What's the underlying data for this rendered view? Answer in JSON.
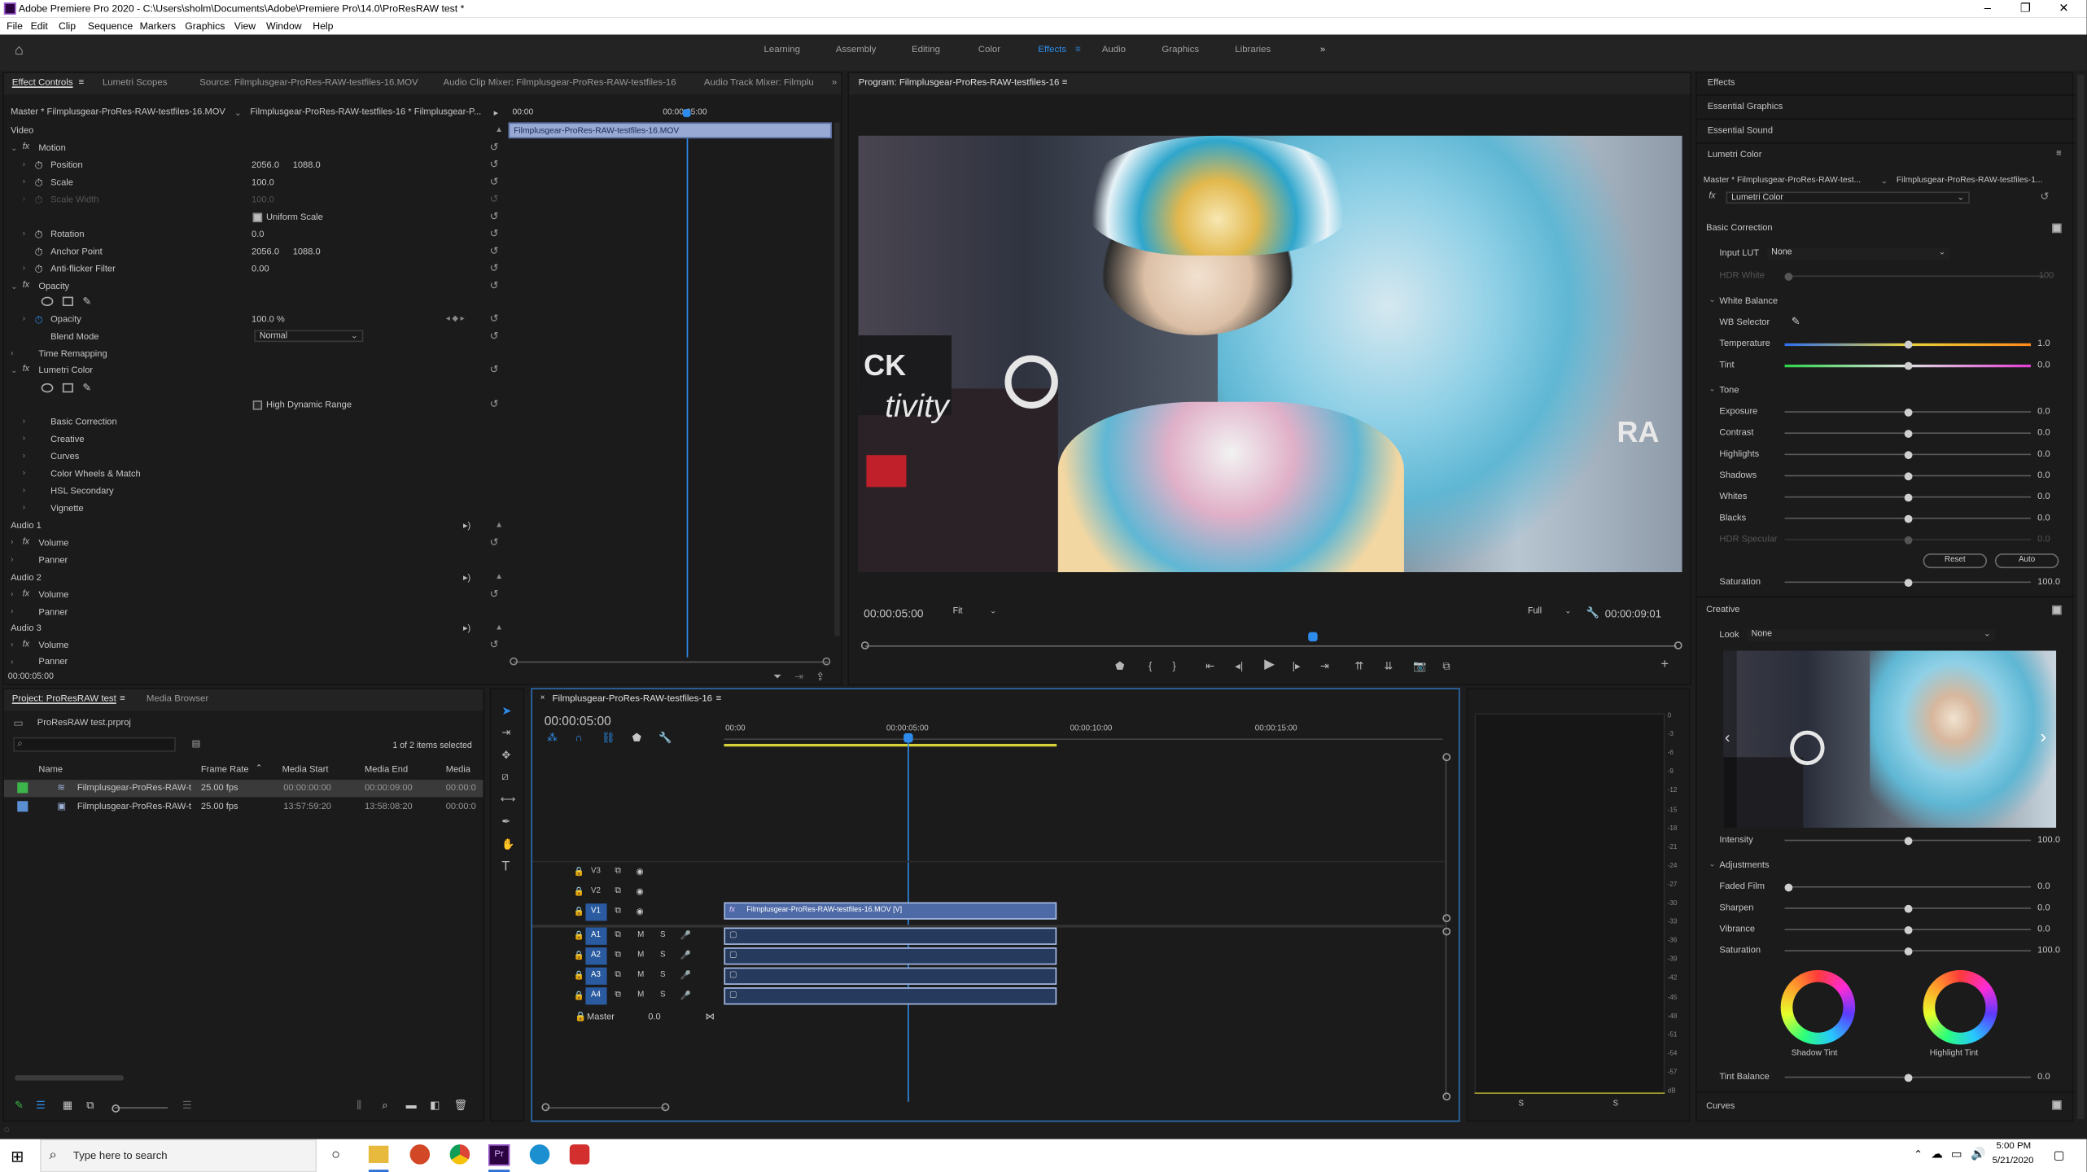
{
  "window": {
    "title": "Adobe Premiere Pro 2020 - C:\\Users\\sholm\\Documents\\Adobe\\Premiere Pro\\14.0\\ProResRAW test *",
    "minimize": "–",
    "maximize": "❐",
    "close": "✕"
  },
  "menu": [
    "File",
    "Edit",
    "Clip",
    "Sequence",
    "Markers",
    "Graphics",
    "View",
    "Window",
    "Help"
  ],
  "workspaces": [
    "Learning",
    "Assembly",
    "Editing",
    "Color",
    "Effects",
    "Audio",
    "Graphics",
    "Libraries"
  ],
  "active_workspace": "Effects",
  "effect_controls": {
    "tabs": [
      "Effect Controls",
      "Lumetri Scopes",
      "Source: Filmplusgear-ProRes-RAW-testfiles-16.MOV",
      "Audio Clip Mixer: Filmplusgear-ProRes-RAW-testfiles-16",
      "Audio Track Mixer: Filmplu"
    ],
    "master": "Master * Filmplusgear-ProRes-RAW-testfiles-16.MOV",
    "sequence": "Filmplusgear-ProRes-RAW-testfiles-16 * Filmplusgear-P...",
    "ruler": [
      "00:00",
      "00:00:05:00"
    ],
    "clip_label": "Filmplusgear-ProRes-RAW-testfiles-16.MOV",
    "video": "Video",
    "motion": "Motion",
    "position": "Position",
    "position_x": "2056.0",
    "position_y": "1088.0",
    "scale": "Scale",
    "scale_val": "100.0",
    "scale_width": "Scale Width",
    "scale_width_val": "100.0",
    "uniform_scale": "Uniform Scale",
    "rotation": "Rotation",
    "rotation_val": "0.0",
    "anchor": "Anchor Point",
    "anchor_x": "2056.0",
    "anchor_y": "1088.0",
    "antiflicker": "Anti-flicker Filter",
    "antiflicker_val": "0.00",
    "opacity_grp": "Opacity",
    "opacity": "Opacity",
    "opacity_val": "100.0 %",
    "blend": "Blend Mode",
    "blend_val": "Normal",
    "time_remap": "Time Remapping",
    "lumetri": "Lumetri Color",
    "hdr": "High Dynamic Range",
    "lumetri_items": [
      "Basic Correction",
      "Creative",
      "Curves",
      "Color Wheels & Match",
      "HSL Secondary",
      "Vignette"
    ],
    "audio1": "Audio 1",
    "audio2": "Audio 2",
    "audio3": "Audio 3",
    "volume": "Volume",
    "panner": "Panner",
    "timecode": "00:00:05:00"
  },
  "program": {
    "title": "Program: Filmplusgear-ProRes-RAW-testfiles-16",
    "timecode": "00:00:05:00",
    "fit": "Fit",
    "full": "Full",
    "duration": "00:00:09:01",
    "image_text": [
      "CK",
      "tivity",
      "RA"
    ]
  },
  "effects_panel": {
    "items": [
      "Effects",
      "Essential Graphics",
      "Essential Sound"
    ],
    "lumetri_title": "Lumetri Color",
    "master": "Master * Filmplusgear-ProRes-RAW-test...",
    "sequence": "Filmplusgear-ProRes-RAW-testfiles-1...",
    "effect_select": "Lumetri Color",
    "basic_correction": "Basic Correction",
    "input_lut": "Input LUT",
    "input_lut_val": "None",
    "hdr_white": "HDR White",
    "hdr_white_val": "100",
    "white_balance": "White Balance",
    "wb_selector": "WB Selector",
    "temperature": "Temperature",
    "temperature_val": "1.0",
    "tint": "Tint",
    "tint_val": "0.0",
    "tone": "Tone",
    "tone_rows": [
      {
        "label": "Exposure",
        "value": "0.0"
      },
      {
        "label": "Contrast",
        "value": "0.0"
      },
      {
        "label": "Highlights",
        "value": "0.0"
      },
      {
        "label": "Shadows",
        "value": "0.0"
      },
      {
        "label": "Whites",
        "value": "0.0"
      },
      {
        "label": "Blacks",
        "value": "0.0"
      },
      {
        "label": "HDR Specular",
        "value": "0.0"
      }
    ],
    "reset": "Reset",
    "auto": "Auto",
    "saturation": "Saturation",
    "saturation_val": "100.0",
    "creative": "Creative",
    "look": "Look",
    "look_val": "None",
    "intensity": "Intensity",
    "intensity_val": "100.0",
    "adjustments": "Adjustments",
    "adj_rows": [
      {
        "label": "Faded Film",
        "value": "0.0"
      },
      {
        "label": "Sharpen",
        "value": "0.0"
      },
      {
        "label": "Vibrance",
        "value": "0.0"
      },
      {
        "label": "Saturation",
        "value": "100.0"
      }
    ],
    "shadow_tint": "Shadow Tint",
    "highlight_tint": "Highlight Tint",
    "tint_balance": "Tint Balance",
    "tint_balance_val": "0.0",
    "curves": "Curves"
  },
  "project": {
    "tabs": [
      "Project: ProResRAW test",
      "Media Browser"
    ],
    "file": "ProResRAW test.prproj",
    "selected": "1 of 2 items selected",
    "columns": [
      "Name",
      "Frame Rate",
      "Media Start",
      "Media End",
      "Media"
    ],
    "rows": [
      {
        "name": "Filmplusgear-ProRes-RAW-t",
        "fps": "25.00 fps",
        "start": "00:00:00:00",
        "end": "00:00:09:00",
        "media": "00:00:0",
        "color": "#3cb64a"
      },
      {
        "name": "Filmplusgear-ProRes-RAW-t",
        "fps": "25.00 fps",
        "start": "13:57:59:20",
        "end": "13:58:08:20",
        "media": "00:00:0",
        "color": "#5b8fd4"
      }
    ]
  },
  "timeline": {
    "title": "Filmplusgear-ProRes-RAW-testfiles-16",
    "timecode": "00:00:05:00",
    "ruler": [
      "00:00",
      "00:00:05:00",
      "00:00:10:00",
      "00:00:15:00"
    ],
    "video_tracks": [
      "V3",
      "V2",
      "V1"
    ],
    "audio_tracks": [
      "A1",
      "A2",
      "A3",
      "A4"
    ],
    "clip_label": "Filmplusgear-ProRes-RAW-testfiles-16.MOV [V]",
    "master": "Master",
    "master_val": "0.0"
  },
  "meter": {
    "ticks": [
      "0",
      "-3",
      "-6",
      "-9",
      "-12",
      "-15",
      "-18",
      "-21",
      "-24",
      "-27",
      "-30",
      "-33",
      "-36",
      "-39",
      "-42",
      "-45",
      "-48",
      "-51",
      "-54",
      "-57",
      "dB"
    ],
    "solo": [
      "S",
      "S"
    ]
  },
  "taskbar": {
    "search": "Type here to search",
    "time": "5:00 PM",
    "date": "5/21/2020"
  }
}
